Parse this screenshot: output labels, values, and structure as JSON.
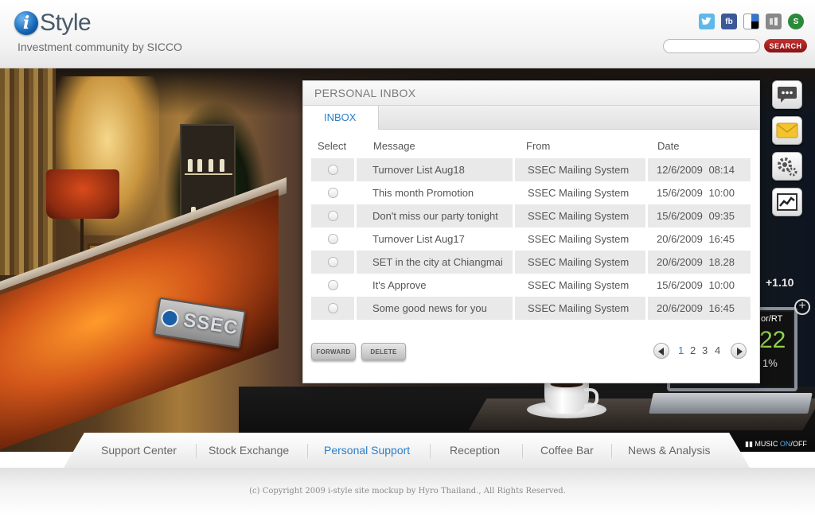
{
  "header": {
    "logo_letter": "i",
    "logo_word": "Style",
    "tagline": "Investment community by SICCO",
    "social": [
      {
        "name": "twitter-icon",
        "glyph": ""
      },
      {
        "name": "facebook-icon",
        "glyph": "fb"
      },
      {
        "name": "delicious-icon",
        "glyph": ""
      },
      {
        "name": "digg-icon",
        "glyph": ""
      },
      {
        "name": "stumbleupon-icon",
        "glyph": "S"
      }
    ],
    "search": {
      "placeholder": "",
      "button_label": "SEARCH"
    }
  },
  "scene": {
    "sign_text": "SSEC",
    "laptop_label": "or/RT",
    "laptop_value": "22",
    "laptop_pct": "1%",
    "ticker": "+1.10"
  },
  "side_icons": [
    {
      "name": "chat-icon"
    },
    {
      "name": "mail-icon"
    },
    {
      "name": "settings-icon"
    },
    {
      "name": "chart-icon"
    }
  ],
  "inbox": {
    "title": "PERSONAL INBOX",
    "tab_label": "INBOX",
    "columns": {
      "select": "Select",
      "message": "Message",
      "from": "From",
      "date": "Date"
    },
    "messages": [
      {
        "message": "Turnover List Aug18",
        "from": "SSEC Mailing System",
        "date": "12/6/2009  08:14"
      },
      {
        "message": "This month Promotion",
        "from": "SSEC Mailing System",
        "date": "15/6/2009  10:00"
      },
      {
        "message": "Don't miss our party tonight",
        "from": "SSEC Mailing System",
        "date": "15/6/2009  09:35"
      },
      {
        "message": "Turnover List Aug17",
        "from": "SSEC Mailing System",
        "date": "20/6/2009  16:45"
      },
      {
        "message": "SET in the city at Chiangmai",
        "from": "SSEC Mailing System",
        "date": "20/6/2009  18.28"
      },
      {
        "message": "It's Approve",
        "from": "SSEC Mailing System",
        "date": "15/6/2009  10:00"
      },
      {
        "message": "Some good news for you",
        "from": "SSEC Mailing System",
        "date": "20/6/2009  16:45"
      }
    ],
    "forward_label": "FORWARD",
    "delete_label": "DELETE",
    "pages": [
      "1",
      "2",
      "3",
      "4"
    ],
    "current_page": "1"
  },
  "nav": {
    "items": [
      "Support Center",
      "Stock Exchange",
      "Personal Support",
      "Reception",
      "Coffee Bar",
      "News & Analysis"
    ],
    "active": "Personal Support",
    "music_label": "MUSIC",
    "music_on": "ON",
    "music_sep": "/",
    "music_off": "OFF"
  },
  "footer": {
    "copyright": "(c) Copyright 2009 i-style site mockup by Hyro Thailand., All Rights Reserved."
  },
  "colors": {
    "accent_blue": "#2a7fc8",
    "search_red": "#b01c1c"
  }
}
